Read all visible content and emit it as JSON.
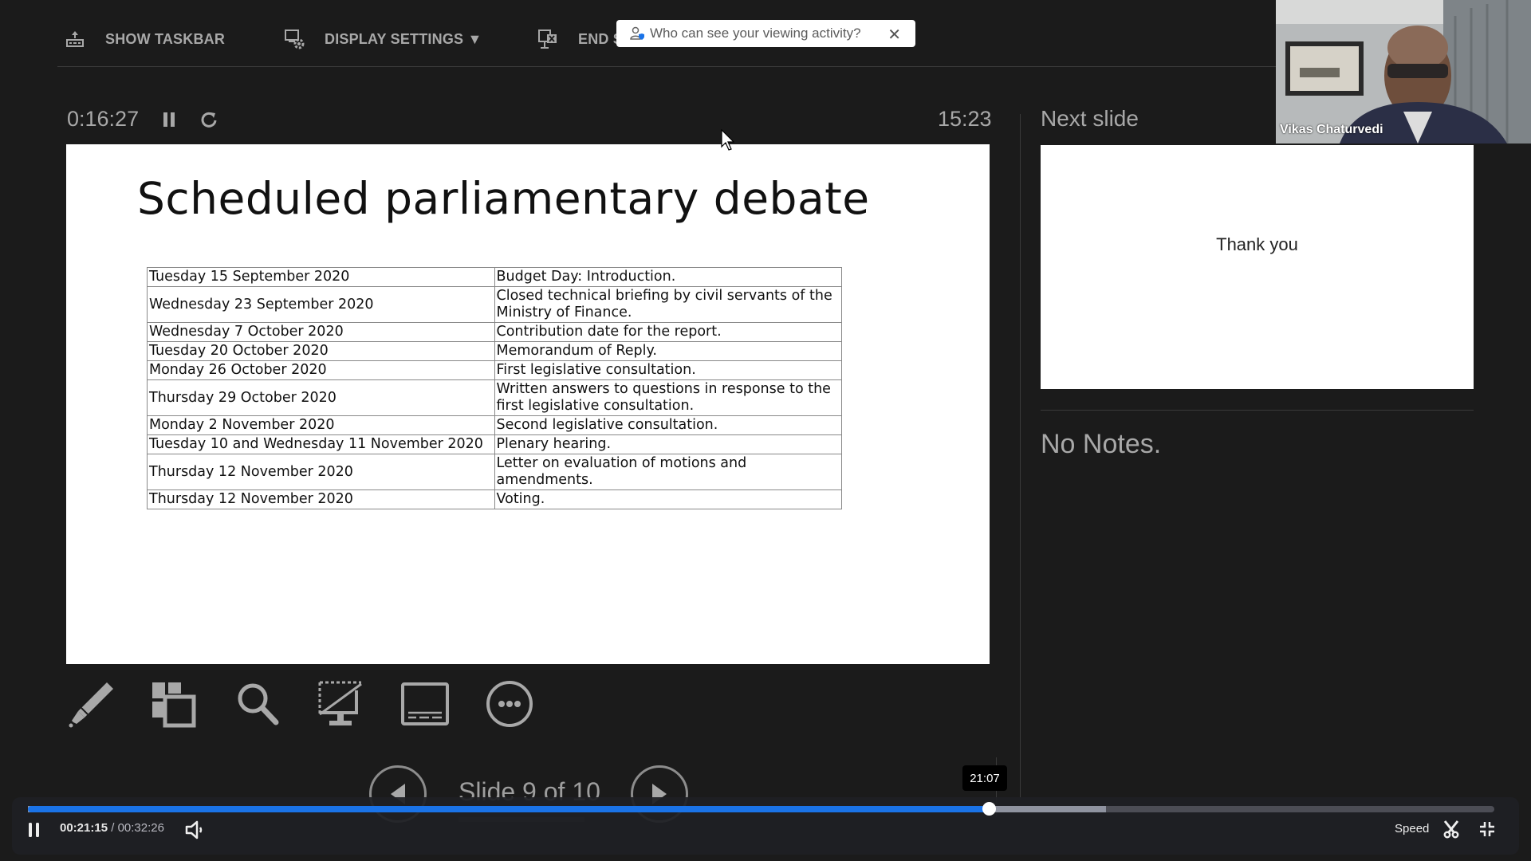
{
  "toolbar": {
    "show_taskbar": "SHOW TASKBAR",
    "display_settings": "DISPLAY SETTINGS ▼",
    "end_show": "END S",
    "icons": [
      "taskbar-icon",
      "display-settings-icon",
      "end-show-icon"
    ]
  },
  "privacy_popup": {
    "text": "Who can see your viewing activity?",
    "close": "✕"
  },
  "webcam": {
    "participant_name": "Vikas Chaturvedi"
  },
  "presenter": {
    "elapsed": "0:16:27",
    "clock": "15:23",
    "slide": {
      "title": "Scheduled parliamentary debate",
      "table": [
        [
          "Tuesday 15 September 2020",
          "Budget Day: Introduction."
        ],
        [
          "Wednesday 23 September 2020",
          "Closed technical briefing by civil servants of the Ministry of Finance."
        ],
        [
          "Wednesday 7 October 2020",
          "Contribution date for the report."
        ],
        [
          "Tuesday 20 October 2020",
          "Memorandum of Reply."
        ],
        [
          "Monday 26 October 2020",
          "First legislative consultation."
        ],
        [
          "Thursday 29 October 2020",
          "Written answers to questions in response to the first legislative consultation."
        ],
        [
          "Monday 2 November 2020",
          "Second legislative consultation."
        ],
        [
          "Tuesday 10 and Wednesday 11 November 2020",
          "Plenary hearing."
        ],
        [
          "Thursday 12 November 2020",
          "Letter on evaluation of motions and amendments."
        ],
        [
          "Thursday 12 November 2020",
          "Voting."
        ]
      ]
    },
    "next_slide_label": "Next slide",
    "next_slide_text": "Thank you",
    "notes": "No Notes.",
    "tools": [
      "pen-icon",
      "see-all-slides-icon",
      "zoom-icon",
      "black-screen-icon",
      "subtitles-icon",
      "more-options-icon"
    ],
    "slide_counter": "Slide 9 of 10",
    "current_slide": 9,
    "total_slides": 10
  },
  "player": {
    "current_time": "00:21:15",
    "separator": " / ",
    "total_time": "00:32:26",
    "hover_time": "21:07",
    "progress_fraction": 0.655,
    "buffer_fraction": 0.735,
    "speed_label": "Speed",
    "accent": "#1a73e8"
  }
}
